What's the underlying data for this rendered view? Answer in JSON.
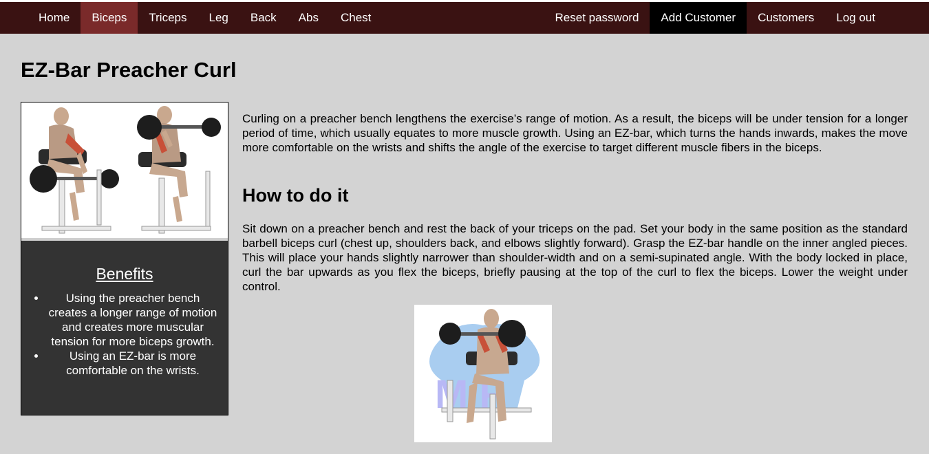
{
  "nav": {
    "left": [
      {
        "label": "Home",
        "active": false
      },
      {
        "label": "Biceps",
        "active": true
      },
      {
        "label": "Triceps",
        "active": false
      },
      {
        "label": "Leg",
        "active": false
      },
      {
        "label": "Back",
        "active": false
      },
      {
        "label": "Abs",
        "active": false
      },
      {
        "label": "Chest",
        "active": false
      }
    ],
    "right": [
      {
        "label": "Reset password",
        "dark": false
      },
      {
        "label": "Add Customer",
        "dark": true
      },
      {
        "label": "Customers",
        "dark": false
      },
      {
        "label": "Log out",
        "dark": false
      }
    ]
  },
  "page": {
    "title": "EZ-Bar Preacher Curl",
    "intro": "Curling on a preacher bench lengthens the exercise’s range of motion. As a result, the biceps will be under tension for a longer period of time, which usually equates to more muscle growth. Using an EZ-bar, which turns the hands inwards, makes the move more comfortable on the wrists and shifts the angle of the exercise to target different muscle fibers in the biceps.",
    "howto_heading": "How to do it",
    "howto_text": "Sit down on a preacher bench and rest the back of your triceps on the pad. Set your body in the same position as the standard barbell biceps curl (chest up, shoulders back, and elbows slightly forward). Grasp the EZ-bar handle on the inner angled pieces. This will place your hands slightly narrower than shoulder-width and on a semi-supinated angle. With the body locked in place, curl the bar upwards as you flex the biceps, briefly pausing at the top of the curl to flex the biceps. Lower the weight under control."
  },
  "benefits": {
    "title": "Benefits",
    "items": [
      "Using the preacher bench creates a longer range of motion and creates more muscular tension for more biceps growth.",
      "Using an EZ-bar is more comfortable on the wrists."
    ]
  },
  "images": {
    "card_image": "preacher-curl-illustration",
    "demo_image": "preacher-curl-demo-illustration",
    "demo_watermark": "M F"
  },
  "colors": {
    "navbar": "#3a1212",
    "nav_active": "#7a2a2a",
    "nav_dark": "#000000",
    "page_bg": "#d3d3d3",
    "card_bg": "#333333"
  }
}
